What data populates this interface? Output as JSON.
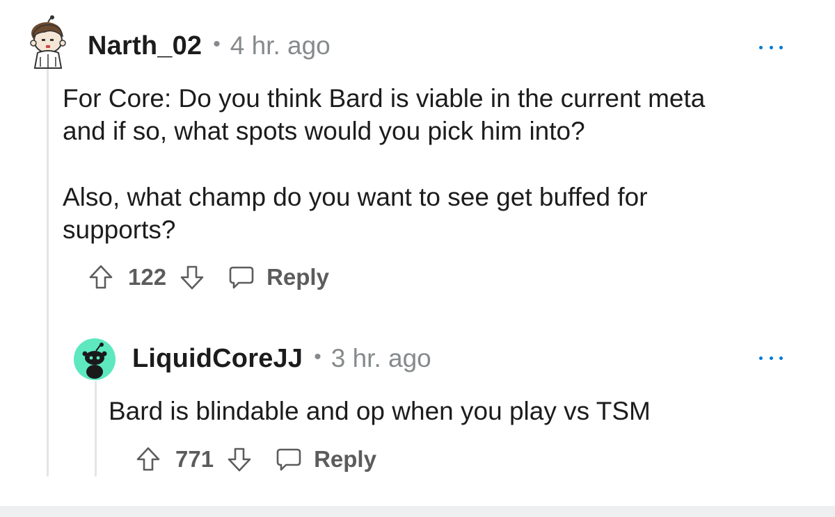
{
  "comments": [
    {
      "username": "Narth_02",
      "separator": "•",
      "time": "4 hr. ago",
      "body": [
        "For Core: Do you think Bard is viable in the current meta",
        "and if so, what spots would you pick him into?",
        "Also, what champ do you want to see get buffed for",
        "supports?"
      ],
      "score": "122",
      "reply_label": "Reply",
      "avatar_icon": "snoo-avatar-icon"
    },
    {
      "username": "LiquidCoreJJ",
      "separator": "•",
      "time": "3 hr. ago",
      "body": [
        "Bard is blindable and op when you play vs TSM"
      ],
      "score": "771",
      "reply_label": "Reply",
      "avatar_icon": "default-snoo-avatar-icon"
    }
  ],
  "colors": {
    "accent": "#0079d3",
    "meta_text": "#878a8c",
    "action_text": "#5c5c5c",
    "thread_line": "#e5e5e5",
    "avatar_teal": "#5de8c0",
    "footer": "#edeff1"
  }
}
